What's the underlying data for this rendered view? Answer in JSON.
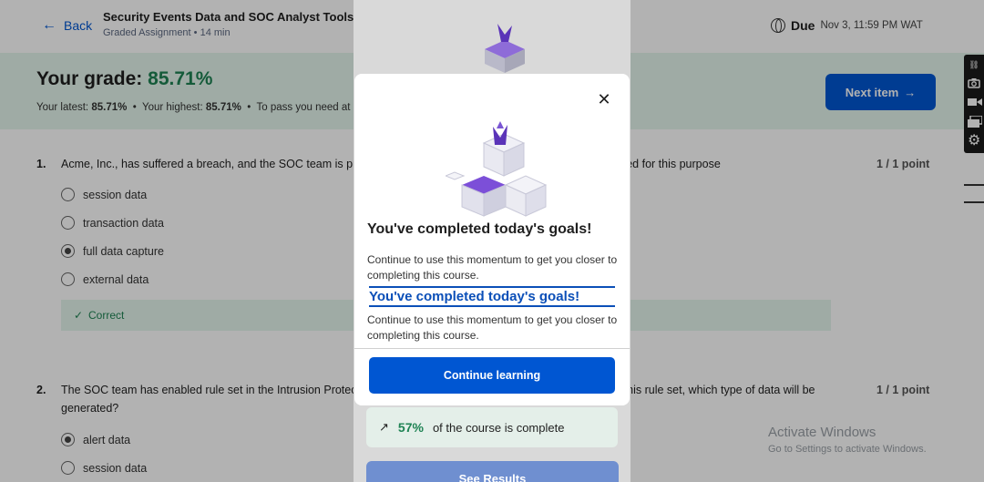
{
  "header": {
    "back_label": "Back",
    "course_title": "Security Events Data and SOC Analyst Tools Course",
    "course_subtitle": "Graded Assignment • 14 min",
    "due_label": "Due",
    "due_date": "Nov 3, 11:59 PM WAT"
  },
  "grade": {
    "label": "Your grade:",
    "value": "85.71%",
    "latest_label": "Your latest:",
    "latest_value": "85.71%",
    "highest_label": "Your highest:",
    "highest_value": "85.71%",
    "pass_text": "To pass you need at least",
    "next_item_label": "Next item"
  },
  "questions": [
    {
      "number": "1.",
      "text": "Acme, Inc., has suffered a breach, and the SOC team is preparing to determine which type of data will be collected for this purpose",
      "points": "1 / 1 point",
      "options": [
        "session data",
        "transaction data",
        "full data capture",
        "external data"
      ],
      "selected": 2,
      "feedback": "Correct"
    },
    {
      "number": "2.",
      "text": "The SOC team has enabled rule set in the Intrusion Protection System so that an alert is received that matches this rule set, which type of data will be generated?",
      "points": "1 / 1 point",
      "options": [
        "alert data",
        "session data"
      ],
      "selected": 0
    }
  ],
  "modal": {
    "heading": "You've completed today's goals!",
    "body": "Continue to use this momentum to get you closer to completing this course.",
    "continue_label": "Continue learning",
    "progress_pct": "57%",
    "progress_text": "of the course is complete",
    "see_results_label": "See Results"
  },
  "watermark": {
    "line1": "Activate Windows",
    "line2": "Go to Settings to activate Windows."
  },
  "colors": {
    "primary": "#0056d2",
    "success": "#1f8354",
    "success_bg": "#e4f5ec"
  }
}
